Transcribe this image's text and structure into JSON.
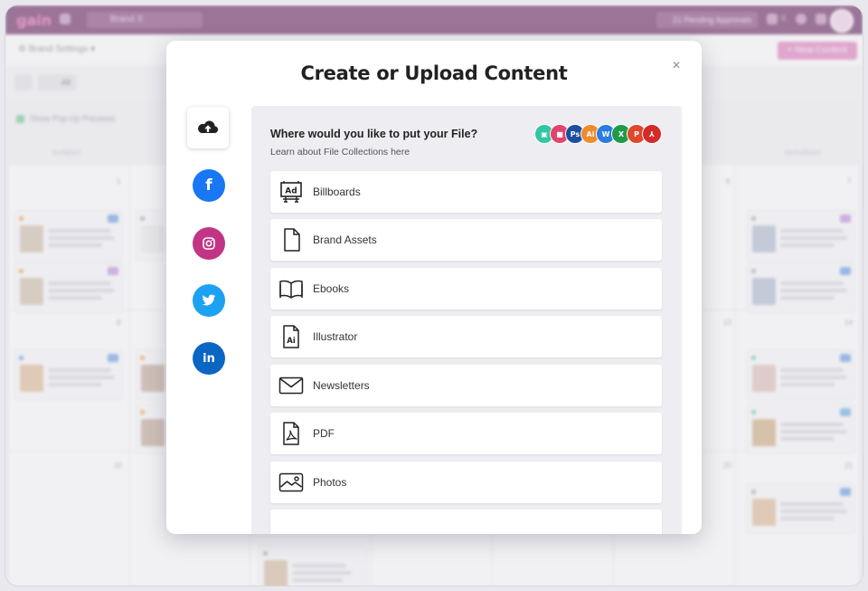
{
  "app": {
    "logo": "gain",
    "brand": "Brand X",
    "pending": "21 Pending Approvals",
    "badge_count": "0",
    "brand_settings": "Brand Settings",
    "new_content": "New Content",
    "filter_all": "All",
    "show_popup": "Show Pop-Up Previews",
    "days": [
      "SUNDAY",
      "SATURDAY"
    ],
    "day_numbers": [
      "1",
      "6",
      "7",
      "8",
      "13",
      "14",
      "15",
      "20",
      "21"
    ]
  },
  "modal": {
    "title": "Create or Upload Content",
    "close_label": "×",
    "sources": [
      {
        "name": "upload",
        "icon": "cloud-upload-icon"
      },
      {
        "name": "facebook",
        "icon": "facebook-icon",
        "color": "#1877f2"
      },
      {
        "name": "instagram",
        "icon": "instagram-icon",
        "color": "#c13584"
      },
      {
        "name": "twitter",
        "icon": "twitter-icon",
        "color": "#1da1f2"
      },
      {
        "name": "linkedin",
        "icon": "linkedin-icon",
        "color": "#0a66c2"
      }
    ],
    "question": "Where would you like to put your File?",
    "learn_link": "Learn about File Collections here",
    "file_types": [
      {
        "label": "▣",
        "color": "#34c6a2"
      },
      {
        "label": "■",
        "color": "#e2446e"
      },
      {
        "label": "Ps",
        "color": "#1b4fa0"
      },
      {
        "label": "Ai",
        "color": "#f08a2b"
      },
      {
        "label": "W",
        "color": "#2b7de0"
      },
      {
        "label": "X",
        "color": "#1f9b48"
      },
      {
        "label": "P",
        "color": "#e0472b"
      },
      {
        "label": "⅄",
        "color": "#d42a2a"
      }
    ],
    "options": [
      {
        "label": "Billboards",
        "icon": "billboard-icon"
      },
      {
        "label": "Brand Assets",
        "icon": "document-icon"
      },
      {
        "label": "Ebooks",
        "icon": "book-icon"
      },
      {
        "label": "Illustrator",
        "icon": "illustrator-file-icon"
      },
      {
        "label": "Newsletters",
        "icon": "envelope-icon"
      },
      {
        "label": "PDF",
        "icon": "pdf-file-icon"
      },
      {
        "label": "Photos",
        "icon": "photo-icon"
      }
    ]
  }
}
